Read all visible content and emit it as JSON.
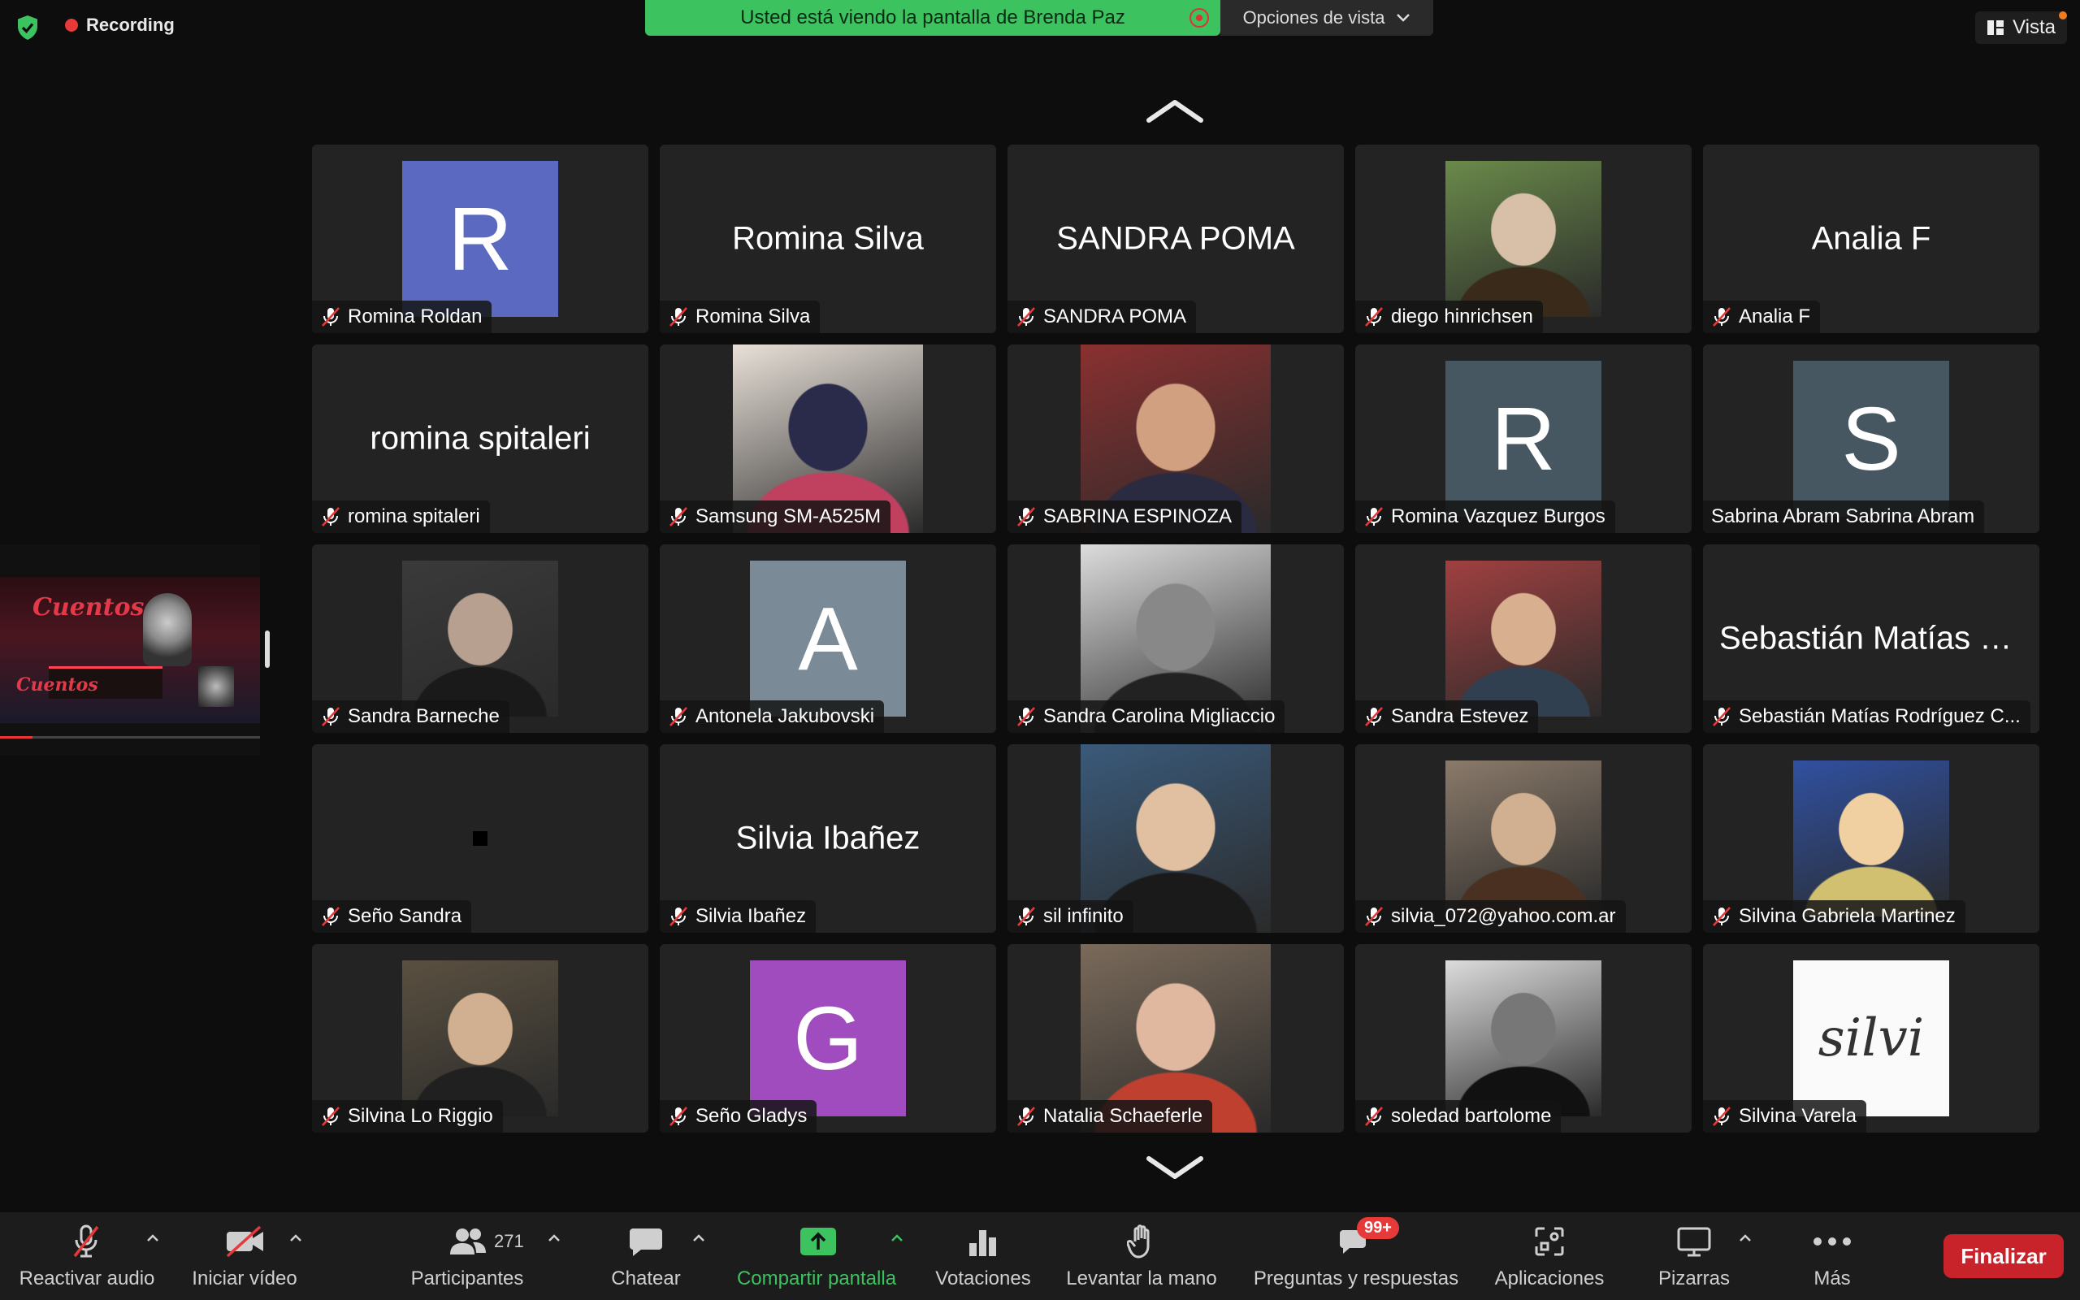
{
  "top": {
    "recording_label": "Recording",
    "banner_text": "Usted está viendo la pantalla de Brenda Paz",
    "view_options_label": "Opciones de vista",
    "vista_label": "Vista"
  },
  "colors": {
    "accent_green": "#3cc35f",
    "end_red": "#c8232b",
    "recording_red": "#e5393a",
    "tile_bg": "#232323"
  },
  "shared_screen": {
    "heading": "Cuentos"
  },
  "tiles": [
    {
      "name": "Romina Roldan",
      "display": "avatar",
      "letter": "R",
      "color": "#5b6ac0"
    },
    {
      "name": "Romina Silva",
      "display": "name",
      "big": "Romina Silva"
    },
    {
      "name": "SANDRA POMA",
      "display": "name",
      "big": "SANDRA POMA"
    },
    {
      "name": "diego hinrichsen",
      "display": "photo"
    },
    {
      "name": "Analia F",
      "display": "name",
      "big": "Analia F"
    },
    {
      "name": "romina spitaleri",
      "display": "name",
      "big": "romina spitaleri"
    },
    {
      "name": "Samsung SM-A525M",
      "display": "photo"
    },
    {
      "name": "SABRINA ESPINOZA",
      "display": "photo"
    },
    {
      "name": "Romina Vazquez Burgos",
      "display": "avatar",
      "letter": "R",
      "color": "#465761"
    },
    {
      "name": "Sabrina Abram Sabrina Abram",
      "display": "avatar",
      "letter": "S",
      "color": "#465761",
      "unmuted": true
    },
    {
      "name": "Sandra Barneche",
      "display": "photo"
    },
    {
      "name": "Antonela Jakubovski",
      "display": "avatar",
      "letter": "A",
      "color": "#7a8a96"
    },
    {
      "name": "Sandra Carolina Migliaccio",
      "display": "photo"
    },
    {
      "name": "Sandra Estevez",
      "display": "photo"
    },
    {
      "name": "Sebastián Matías Rodríguez C...",
      "display": "name",
      "big": "Sebastián Matías R..."
    },
    {
      "name": "Seño Sandra",
      "display": "blank"
    },
    {
      "name": "Silvia Ibañez",
      "display": "name",
      "big": "Silvia Ibañez"
    },
    {
      "name": "sil infinito",
      "display": "photo"
    },
    {
      "name": "silvia_072@yahoo.com.ar",
      "display": "photo"
    },
    {
      "name": "Silvina Gabriela Martinez",
      "display": "photo"
    },
    {
      "name": "Silvina Lo Riggio",
      "display": "photo"
    },
    {
      "name": "Seño Gladys",
      "display": "avatar",
      "letter": "G",
      "color": "#a04cbf"
    },
    {
      "name": "Natalia Schaeferle",
      "display": "photo"
    },
    {
      "name": "soledad bartolome",
      "display": "photo"
    },
    {
      "name": "Silvina Varela",
      "display": "photo",
      "photo_text": "silvi"
    }
  ],
  "toolbar": {
    "unmute": "Reactivar audio",
    "start_video": "Iniciar vídeo",
    "participants": "Participantes",
    "participants_count": "271",
    "chat": "Chatear",
    "share": "Compartir pantalla",
    "polls": "Votaciones",
    "raise_hand": "Levantar la mano",
    "qa": "Preguntas y respuestas",
    "qa_badge": "99+",
    "apps": "Aplicaciones",
    "whiteboards": "Pizarras",
    "more": "Más",
    "end": "Finalizar"
  }
}
